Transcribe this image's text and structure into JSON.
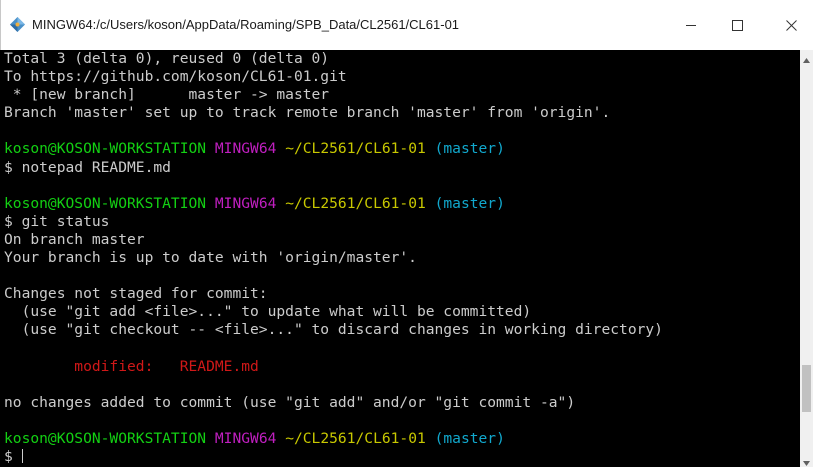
{
  "window": {
    "title": "MINGW64:/c/Users/koson/AppData/Roaming/SPB_Data/CL2561/CL61-01",
    "icon": "git-bash-icon",
    "controls": [
      "minimize-icon",
      "maximize-icon",
      "close-icon"
    ]
  },
  "terminal": {
    "background": "#000000",
    "lines": [
      {
        "segments": [
          {
            "text": "Total 3 (delta 0), reused 0 (delta 0)",
            "color": "default"
          }
        ]
      },
      {
        "segments": [
          {
            "text": "To https://github.com/koson/CL61-01.git",
            "color": "default"
          }
        ]
      },
      {
        "segments": [
          {
            "text": " * [new branch]      master -> master",
            "color": "default"
          }
        ]
      },
      {
        "segments": [
          {
            "text": "Branch 'master' set up to track remote branch 'master' from 'origin'.",
            "color": "default"
          }
        ]
      },
      {
        "segments": [
          {
            "text": "",
            "color": "default"
          }
        ]
      },
      {
        "segments": [
          {
            "text": "koson@KOSON-WORKSTATION",
            "color": "green"
          },
          {
            "text": " ",
            "color": "default"
          },
          {
            "text": "MINGW64",
            "color": "magenta"
          },
          {
            "text": " ",
            "color": "default"
          },
          {
            "text": "~/CL2561/CL61-01",
            "color": "yellow"
          },
          {
            "text": " ",
            "color": "default"
          },
          {
            "text": "(master)",
            "color": "cyan"
          }
        ]
      },
      {
        "segments": [
          {
            "text": "$ notepad README.md",
            "color": "default"
          }
        ]
      },
      {
        "segments": [
          {
            "text": "",
            "color": "default"
          }
        ]
      },
      {
        "segments": [
          {
            "text": "koson@KOSON-WORKSTATION",
            "color": "green"
          },
          {
            "text": " ",
            "color": "default"
          },
          {
            "text": "MINGW64",
            "color": "magenta"
          },
          {
            "text": " ",
            "color": "default"
          },
          {
            "text": "~/CL2561/CL61-01",
            "color": "yellow"
          },
          {
            "text": " ",
            "color": "default"
          },
          {
            "text": "(master)",
            "color": "cyan"
          }
        ]
      },
      {
        "segments": [
          {
            "text": "$ git status",
            "color": "default"
          }
        ]
      },
      {
        "segments": [
          {
            "text": "On branch master",
            "color": "default"
          }
        ]
      },
      {
        "segments": [
          {
            "text": "Your branch is up to date with 'origin/master'.",
            "color": "default"
          }
        ]
      },
      {
        "segments": [
          {
            "text": "",
            "color": "default"
          }
        ]
      },
      {
        "segments": [
          {
            "text": "Changes not staged for commit:",
            "color": "default"
          }
        ]
      },
      {
        "segments": [
          {
            "text": "  (use \"git add <file>...\" to update what will be committed)",
            "color": "default"
          }
        ]
      },
      {
        "segments": [
          {
            "text": "  (use \"git checkout -- <file>...\" to discard changes in working directory)",
            "color": "default"
          }
        ]
      },
      {
        "segments": [
          {
            "text": "",
            "color": "default"
          }
        ]
      },
      {
        "segments": [
          {
            "text": "        modified:   README.md",
            "color": "red"
          }
        ]
      },
      {
        "segments": [
          {
            "text": "",
            "color": "default"
          }
        ]
      },
      {
        "segments": [
          {
            "text": "no changes added to commit (use \"git add\" and/or \"git commit -a\")",
            "color": "default"
          }
        ]
      },
      {
        "segments": [
          {
            "text": "",
            "color": "default"
          }
        ]
      },
      {
        "segments": [
          {
            "text": "koson@KOSON-WORKSTATION",
            "color": "green"
          },
          {
            "text": " ",
            "color": "default"
          },
          {
            "text": "MINGW64",
            "color": "magenta"
          },
          {
            "text": " ",
            "color": "default"
          },
          {
            "text": "~/CL2561/CL61-01",
            "color": "yellow"
          },
          {
            "text": " ",
            "color": "default"
          },
          {
            "text": "(master)",
            "color": "cyan"
          }
        ]
      },
      {
        "segments": [
          {
            "text": "$ ",
            "color": "default"
          }
        ],
        "cursor": true
      }
    ]
  },
  "colors": {
    "default": "#cccccc",
    "green": "#13d013",
    "magenta": "#c01fc0",
    "yellow": "#c8c800",
    "cyan": "#11a8cd",
    "red": "#d01818"
  },
  "scrollbar": {
    "position_fraction": 0.88,
    "visible_fraction": 0.12
  }
}
